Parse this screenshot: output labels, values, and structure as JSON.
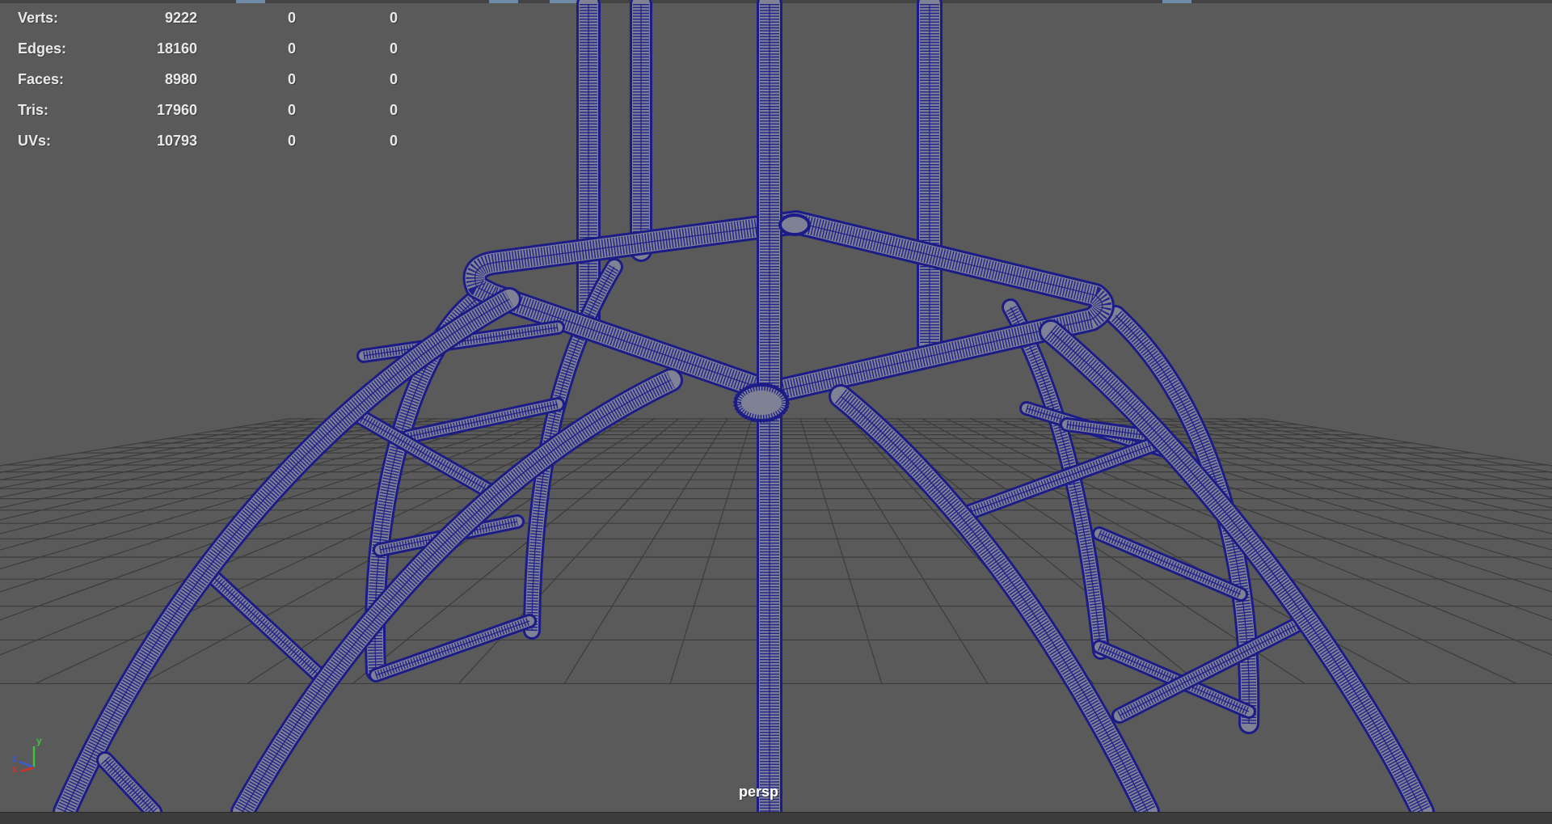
{
  "hud": {
    "rows": [
      {
        "label": "Verts:",
        "v1": "9222",
        "v2": "0",
        "v3": "0"
      },
      {
        "label": "Edges:",
        "v1": "18160",
        "v2": "0",
        "v3": "0"
      },
      {
        "label": "Faces:",
        "v1": "8980",
        "v2": "0",
        "v3": "0"
      },
      {
        "label": "Tris:",
        "v1": "17960",
        "v2": "0",
        "v3": "0"
      },
      {
        "label": "UVs:",
        "v1": "10793",
        "v2": "0",
        "v3": "0"
      }
    ]
  },
  "viewport": {
    "camera": "persp",
    "background_color": "#5a5a5a",
    "grid_color": "#3c3c3c",
    "wireframe_color": "#1c1c88",
    "mesh_fill_color": "#7f8194"
  },
  "axis_gizmo": {
    "x_label": "x",
    "y_label": "y",
    "z_label": "z",
    "x_color": "#d23030",
    "y_color": "#3ec43e",
    "z_color": "#3a5ad8"
  }
}
